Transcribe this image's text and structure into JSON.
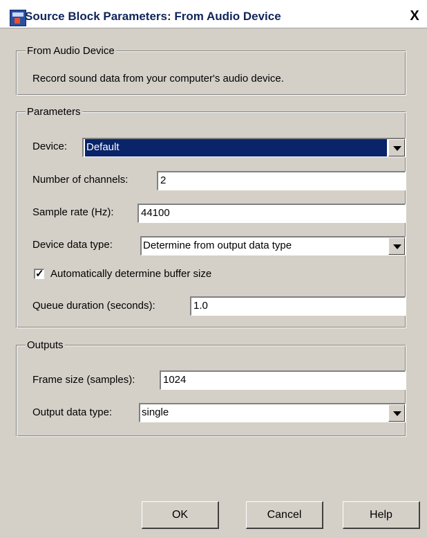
{
  "window": {
    "title": "Source Block Parameters: From Audio Device",
    "close_glyph": "X",
    "icon": "simulink-block-icon"
  },
  "description_group": {
    "legend": "From Audio Device",
    "text": "Record sound data from your computer's audio device."
  },
  "parameters": {
    "legend": "Parameters",
    "device_label": "Device:",
    "device_value": "Default",
    "channels_label": "Number of channels:",
    "channels_value": "2",
    "sample_rate_label": "Sample rate (Hz):",
    "sample_rate_value": "44100",
    "data_type_label": "Device data type:",
    "data_type_value": "Determine from output data type",
    "auto_buffer_label": "Automatically determine buffer size",
    "auto_buffer_checked": true,
    "checkmark_glyph": "✓",
    "queue_label": "Queue duration (seconds):",
    "queue_value": "1.0"
  },
  "outputs": {
    "legend": "Outputs",
    "frame_size_label": "Frame size (samples):",
    "frame_size_value": "1024",
    "output_type_label": "Output data type:",
    "output_type_value": "single"
  },
  "buttons": {
    "ok": "OK",
    "cancel": "Cancel",
    "help": "Help"
  },
  "colors": {
    "selection": "#0a246a",
    "dialog_bg": "#d4d0c8"
  }
}
